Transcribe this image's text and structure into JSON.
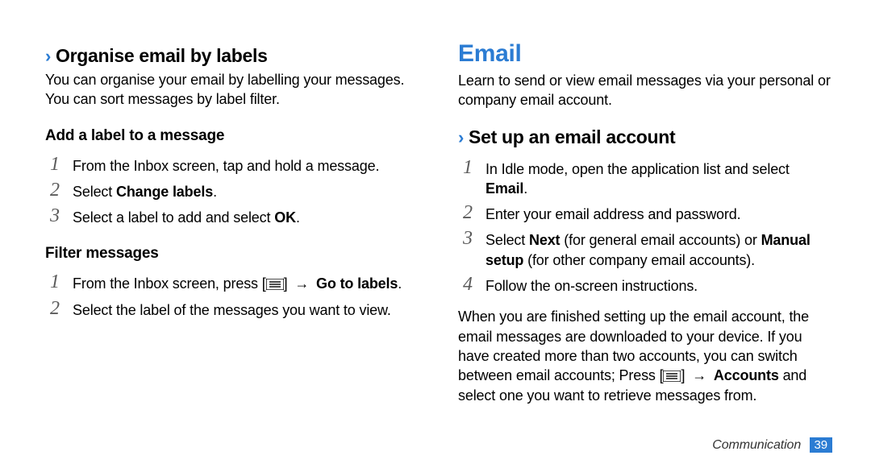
{
  "left": {
    "h2": "Organise email by labels",
    "intro": "You can organise your email by labelling your messages. You can sort messages by label filter.",
    "sectionA": {
      "title": "Add a label to a message",
      "steps": [
        {
          "n": "1",
          "plain": "From the Inbox screen, tap and hold a message."
        },
        {
          "n": "2",
          "pre": "Select ",
          "bold": "Change labels",
          "post": "."
        },
        {
          "n": "3",
          "pre": "Select a label to add and select ",
          "bold": "OK",
          "post": "."
        }
      ]
    },
    "sectionB": {
      "title": "Filter messages",
      "steps": [
        {
          "n": "1",
          "pre": "From the Inbox screen, press [",
          "icon": "menu",
          "mid": "] ",
          "arrow": "→",
          "mid2": " ",
          "bold": "Go to labels",
          "post": "."
        },
        {
          "n": "2",
          "plain": "Select the label of the messages you want to view."
        }
      ]
    }
  },
  "right": {
    "h1": "Email",
    "intro": "Learn to send or view email messages via your personal or company email account.",
    "h2": "Set up an email account",
    "steps": [
      {
        "n": "1",
        "pre": "In Idle mode, open the application list and select ",
        "bold": "Email",
        "post": "."
      },
      {
        "n": "2",
        "plain": "Enter your email address and password."
      },
      {
        "n": "3",
        "pre": "Select ",
        "bold": "Next",
        "mid": " (for general email accounts) or ",
        "bold2": "Manual setup",
        "post": " (for other company email accounts)."
      },
      {
        "n": "4",
        "plain": "Follow the on-screen instructions."
      }
    ],
    "outro_pre": "When you are finished setting up the email account, the email messages are downloaded to your device. If you have created more than two accounts, you can switch between email accounts; Press [",
    "outro_icon": "menu",
    "outro_mid": "] ",
    "outro_arrow": "→",
    "outro_mid2": " ",
    "outro_bold": "Accounts",
    "outro_post": " and select one you want to retrieve messages from."
  },
  "footer": {
    "section": "Communication",
    "page": "39"
  }
}
